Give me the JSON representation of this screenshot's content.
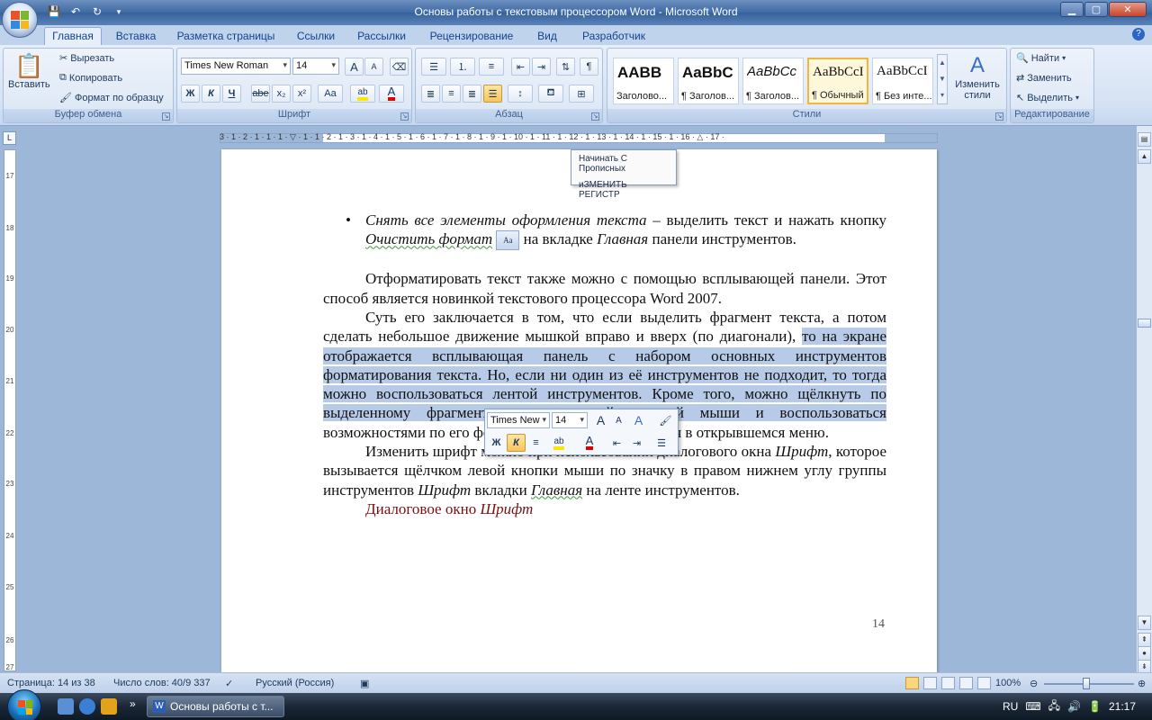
{
  "window": {
    "title": "Основы работы с текстовым процессором Word - Microsoft Word",
    "controls": [
      "minimize-icon",
      "maximize-icon",
      "close-icon"
    ]
  },
  "qat": [
    "save-icon",
    "undo-icon",
    "redo-icon",
    "customize-qat-icon"
  ],
  "tabs": [
    "Главная",
    "Вставка",
    "Разметка страницы",
    "Ссылки",
    "Рассылки",
    "Рецензирование",
    "Вид",
    "Разработчик"
  ],
  "ribbon": {
    "clipboard": {
      "label": "Буфер обмена",
      "paste": "Вставить",
      "cut": "Вырезать",
      "copy": "Копировать",
      "format_painter": "Формат по образцу"
    },
    "font": {
      "label": "Шрифт",
      "font_name": "Times New Roman",
      "font_size": "14",
      "bold": "Ж",
      "italic": "К",
      "underline": "Ч",
      "strike": "abe",
      "subscript": "x₂",
      "superscript": "x²",
      "change_case": "Aa",
      "grow": "A",
      "shrink": "A"
    },
    "paragraph": {
      "label": "Абзац"
    },
    "styles": {
      "label": "Стили",
      "items": [
        {
          "sample": "AABB",
          "name": "Заголово..."
        },
        {
          "sample": "AaBbC",
          "name": "¶ Заголов..."
        },
        {
          "sample": "AaBbCc",
          "name": "¶ Заголов..."
        },
        {
          "sample": "AaBbCcI",
          "name": "¶ Обычный"
        },
        {
          "sample": "AaBbCcI",
          "name": "¶ Без инте..."
        }
      ],
      "change_styles": "Изменить стили"
    },
    "editing": {
      "label": "Редактирование",
      "find": "Найти",
      "replace": "Заменить",
      "select": "Выделить"
    }
  },
  "ruler": {
    "horizontal": "3 · 1 · 2 · 1 · 1 · 1 · ▽ · 1 · 1 · 2 · 1 · 3 · 1 · 4 · 1 · 5 · 1 · 6 · 1 · 7 · 1 · 8 · 1 · 9 · 1 · 10 · 1 · 11 · 1 · 12 · 1 · 13 · 1 · 14 · 1 · 15 · 1 · 16 · △ · 17 ·",
    "vertical": [
      "17",
      "18",
      "19",
      "20",
      "21",
      "22",
      "23",
      "24",
      "25",
      "26",
      "27"
    ]
  },
  "case_menu": {
    "items": [
      "Начинать С Прописных",
      "иЗМЕНИТЬ РЕГИСТР"
    ]
  },
  "document": {
    "bullet": {
      "italic_lead": "Снять все элементы оформления текста",
      "part1": " – выделить текст и нажать кнопку ",
      "button_name": "Очистить формат",
      "part2": " на вкладке ",
      "tab_name": "Главная",
      "part3": " панели инструментов."
    },
    "p1": "Отформатировать текст также можно с помощью всплывающей панели.  Этот способ является новинкой текстового процессора Word 2007.",
    "p2_before": "Суть его заключается в том, что если выделить фрагмент текста, а потом сделать небольшое движение мышкой вправо и вверх (по диагонали), ",
    "p2_highlight": "то на экране отображается всплывающая панель с набором основных инструментов форматирования текста. Но, если  ни один из её инструментов не подходит, то тогда можно воспользоваться лентой инструментов. Кроме того, можно щёлкнуть по выделенному фрагменту текста правой кнопкой мыши и воспользоваться",
    "p2_after": " возможностями по его форматированию, имеющимися  в открывшемся меню.",
    "p3_a": "Изменить шрифт можно при использовании диалогового окна ",
    "p3_font": "Шрифт",
    "p3_b": ", которое вызывается щёлчком левой кнопки мыши по значку в правом нижнем углу группы инструментов ",
    "p3_font2": "Шрифт",
    "p3_c": " вкладки ",
    "p3_home": "Главная",
    "p3_d": " на ленте инструментов.",
    "caption_a": "Диалоговое окно ",
    "caption_b": "Шрифт",
    "page_number": "14"
  },
  "mini_toolbar": {
    "font_name": "Times New",
    "font_size": "14",
    "bold": "Ж",
    "italic": "К"
  },
  "statusbar": {
    "page": "Страница: 14 из 38",
    "words": "Число слов: 40/9 337",
    "language": "Русский (Россия)",
    "zoom": "100%"
  },
  "taskbar": {
    "task": "Основы работы с т...",
    "lang": "RU",
    "time": "21:17"
  },
  "colors": {
    "selection": "#b7cbe8",
    "caption_red": "#7a1010",
    "ribbon_blue": "#15428b"
  }
}
